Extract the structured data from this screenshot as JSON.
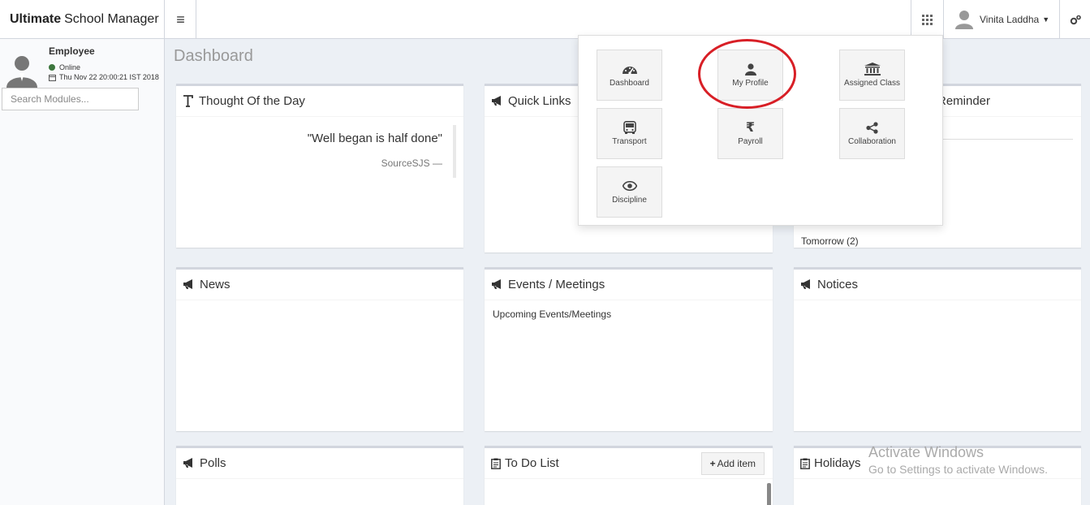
{
  "header": {
    "brand_bold": "Ultimate",
    "brand_rest": "School Manager",
    "toggle_icon": "hamburger-icon",
    "user_name": "Vinita Laddha"
  },
  "sidebar": {
    "role": "Employee",
    "status": "Online",
    "datetime": "Thu Nov 22 20:00:21 IST 2018",
    "search_placeholder": "Search Modules..."
  },
  "page": {
    "title": "Dashboard"
  },
  "boxes": {
    "thought": {
      "title": "Thought Of the Day",
      "quote": "\"Well began is half done\"",
      "source": "SourceSJS —"
    },
    "quick_links": {
      "title": "Quick Links"
    },
    "reminder": {
      "title": "Reminder",
      "tomorrow": "Tomorrow (2)"
    },
    "news": {
      "title": "News"
    },
    "events": {
      "title": "Events / Meetings",
      "subtitle": "Upcoming Events/Meetings"
    },
    "notices": {
      "title": "Notices"
    },
    "polls": {
      "title": "Polls"
    },
    "todo": {
      "title": "To Do List",
      "add_label": "Add item"
    },
    "holidays": {
      "title": "Holidays"
    }
  },
  "apps_menu": {
    "items": [
      {
        "label": "Dashboard",
        "icon": "dashboard-icon"
      },
      {
        "label": "My Profile",
        "icon": "user-icon"
      },
      {
        "label": "Assigned Class",
        "icon": "institution-icon"
      },
      {
        "label": "Transport",
        "icon": "bus-icon"
      },
      {
        "label": "Payroll",
        "icon": "rupee-icon"
      },
      {
        "label": "Collaboration",
        "icon": "share-icon"
      },
      {
        "label": "Discipline",
        "icon": "eye-icon"
      }
    ]
  },
  "watermark": {
    "line1": "Activate Windows",
    "line2": "Go to Settings to activate Windows."
  },
  "colors": {
    "background": "#ecf0f5",
    "annotation_ring": "#d81f26",
    "online": "#3c763d"
  }
}
